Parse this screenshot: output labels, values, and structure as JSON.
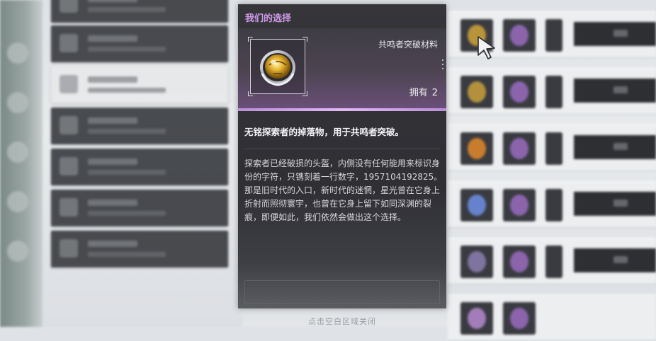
{
  "item": {
    "name": "我们的选择",
    "category": "共鸣者突破材料",
    "owned_label": "拥有",
    "owned_count": "2",
    "summary": "无铭探索者的掉落物，用于共鸣者突破。",
    "description": [
      "探索者已经破损的头盔，内侧没有任何能用来标识身份的字符，只镌刻着一行数字，1957104192825。",
      "那是旧时代的入口，新时代的迷惘，星光曾在它身上折射而照彻寰宇，也曾在它身上留下如同深渊的裂痕，即便如此，我们依然会做出这个选择。"
    ]
  },
  "footer": {
    "close_hint": "点击空白区域关闭"
  },
  "colors": {
    "title_accent": "#d09be8",
    "rarity_bar": "#e2b7f6"
  }
}
